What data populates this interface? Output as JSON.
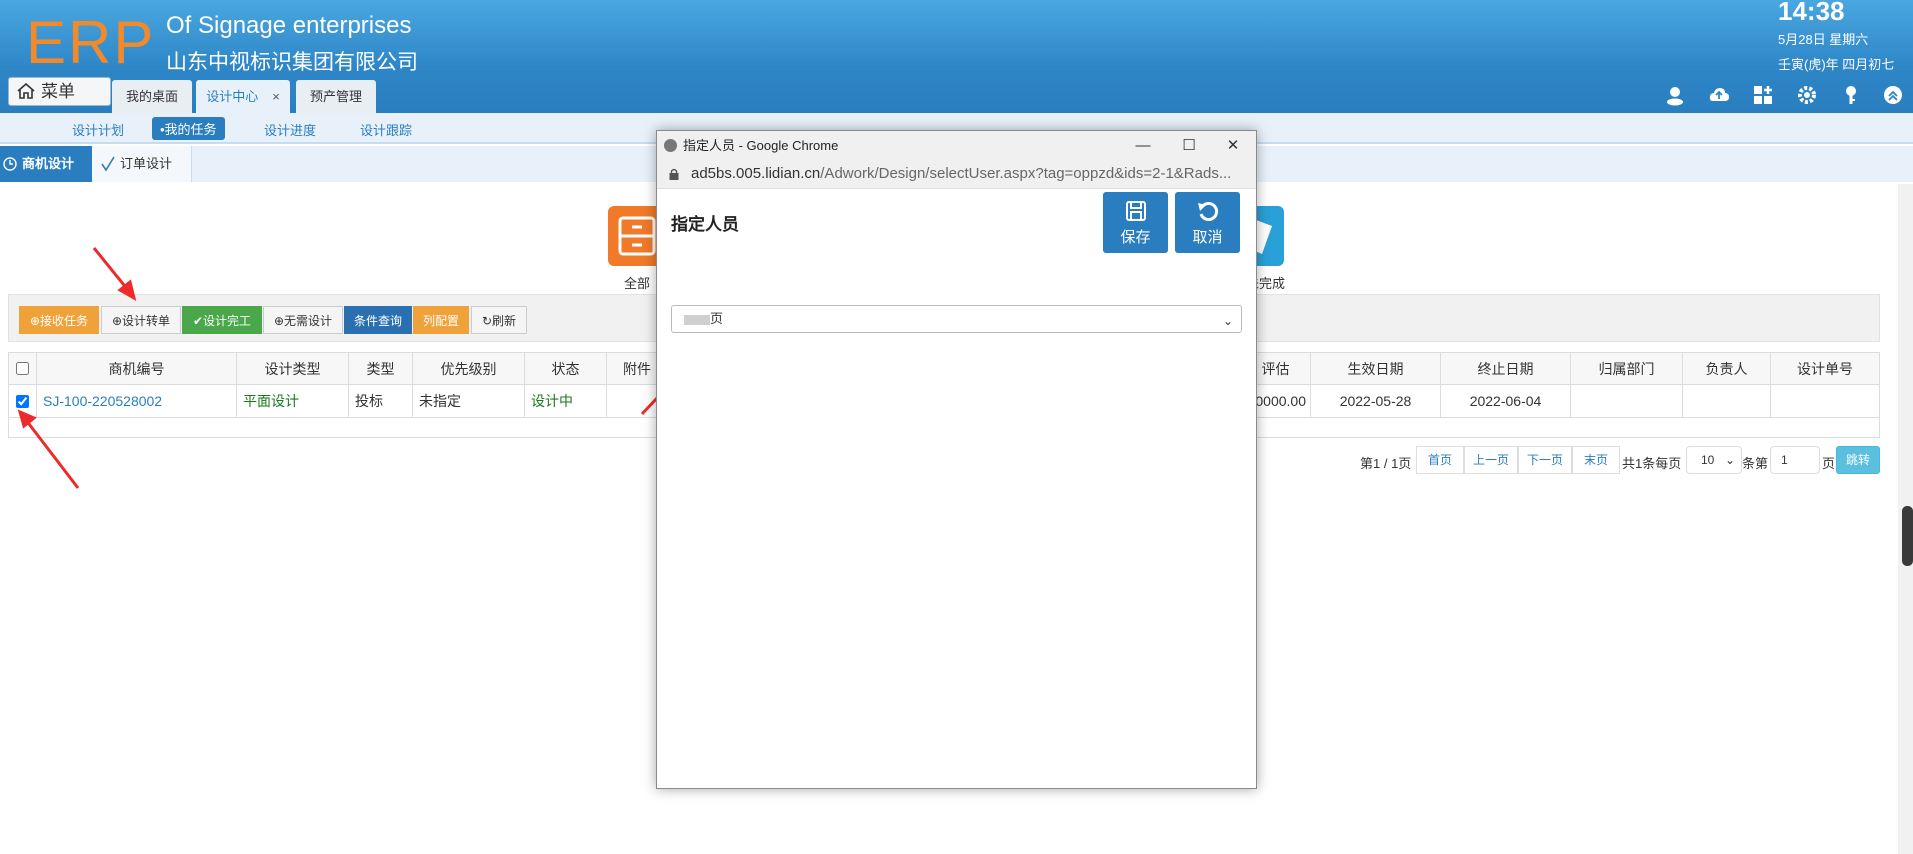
{
  "header": {
    "logo": "ERP",
    "subtitle_en": "Of Signage enterprises",
    "company": "山东中视标识集团有限公司",
    "time": "14:38",
    "date": "5月28日 星期六",
    "lunar": "壬寅(虎)年 四月初七",
    "menu_label": "菜单",
    "tabs": [
      {
        "label": "我的桌面"
      },
      {
        "label": "设计中心",
        "close": "×"
      },
      {
        "label": "预产管理"
      }
    ],
    "icons": [
      "user-icon",
      "cloud-upload-icon",
      "apps-icon",
      "settings-icon",
      "key-icon",
      "collapse-icon"
    ]
  },
  "subnav": {
    "items": [
      "设计计划",
      "•我的任务",
      "设计进度",
      "设计跟踪"
    ]
  },
  "module_tabs": [
    "商机设计",
    "订单设计"
  ],
  "big_icons": [
    {
      "label": "全部",
      "color": "#f07a2a",
      "icon": "drawer-icon"
    },
    {
      "label": "未完成",
      "color": "#2aa0d8",
      "icon": "document-icon"
    }
  ],
  "toolbar": {
    "buttons": [
      {
        "label": "⊕接收任务",
        "bg": "#f0a23a",
        "fg": "#ffffff"
      },
      {
        "label": "⊕设计转单",
        "bg": "#f5f5f5",
        "fg": "#333333"
      },
      {
        "label": "✔设计完工",
        "bg": "#4aa84a",
        "fg": "#ffffff"
      },
      {
        "label": "⊕无需设计",
        "bg": "#f5f5f5",
        "fg": "#333333"
      },
      {
        "label": "条件查询",
        "bg": "#2a6fb0",
        "fg": "#ffffff"
      },
      {
        "label": "列配置",
        "bg": "#f0a23a",
        "fg": "#ffffff"
      },
      {
        "label": "↻刷新",
        "bg": "#f5f5f5",
        "fg": "#333333"
      }
    ]
  },
  "table": {
    "headers_left": [
      "商机编号",
      "设计类型",
      "类型",
      "优先级别",
      "状态",
      "附件"
    ],
    "headers_right": [
      "评估",
      "生效日期",
      "终止日期",
      "归属部门",
      "负责人",
      "设计单号"
    ],
    "row_left": [
      "SJ-100-220528002",
      "平面设计",
      "投标",
      "未指定",
      "设计中",
      ""
    ],
    "row_right": [
      "0000.00",
      "2022-05-28",
      "2022-06-04",
      "",
      "",
      ""
    ]
  },
  "pager": {
    "info": "第1 / 1页",
    "buttons": [
      "首页",
      "上一页",
      "下一页",
      "末页"
    ],
    "total_text": "共1条每页",
    "per_page": "10",
    "per_unit": "条第",
    "page_value": "1",
    "page_unit": "页",
    "go": "跳转"
  },
  "modal": {
    "window_title": "指定人员 - Google Chrome",
    "url_host": "ad5bs.005.lidian.cn",
    "url_path": "/Adwork/Design/selectUser.aspx?tag=oppzd&ids=2-1&Rads...",
    "heading": "指定人员",
    "save": "保存",
    "cancel": "取消",
    "select_value": "页",
    "controls": [
      "—",
      "☐",
      "✕"
    ]
  }
}
